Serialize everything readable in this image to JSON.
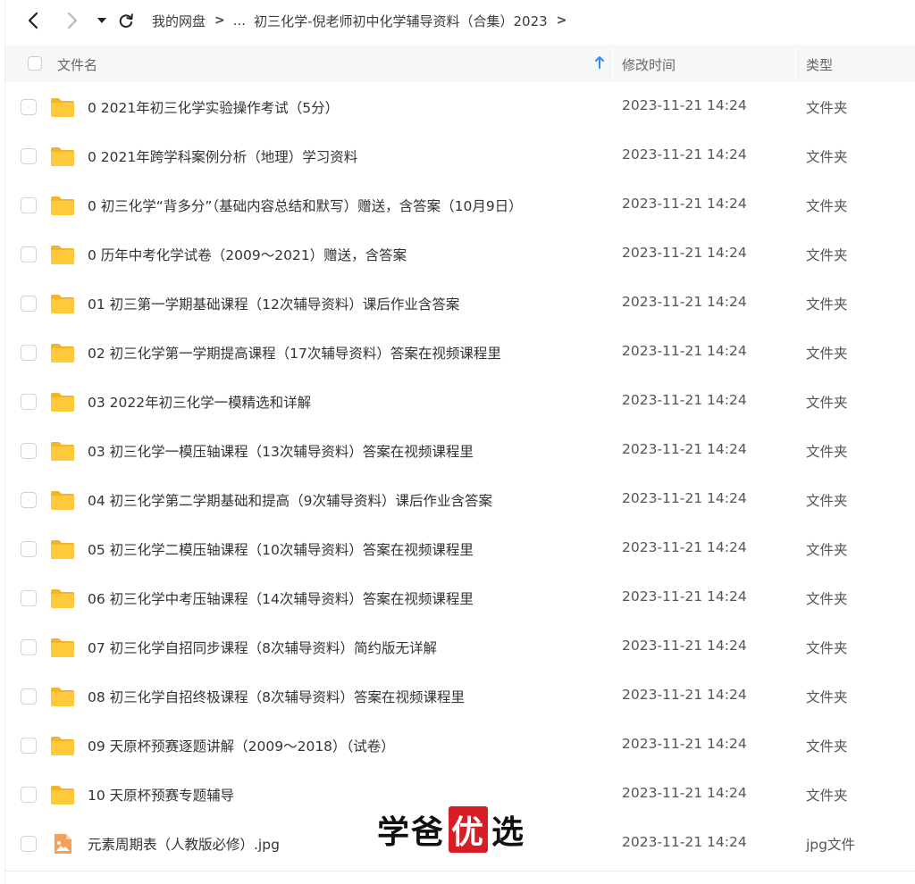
{
  "breadcrumb": {
    "root": "我的网盘",
    "ellipsis": "...",
    "current": "初三化学-倪老师初中化学辅导资料（合集）2023"
  },
  "table": {
    "columns": {
      "name": "文件名",
      "modified": "修改时间",
      "type": "类型"
    },
    "sort": {
      "column": "name",
      "direction": "asc"
    },
    "rows": [
      {
        "name": "0 2021年初三化学实验操作考试（5分）",
        "modified": "2023-11-21 14:24",
        "type": "文件夹",
        "icon": "folder-icon"
      },
      {
        "name": "0 2021年跨学科案例分析（地理）学习资料",
        "modified": "2023-11-21 14:24",
        "type": "文件夹",
        "icon": "folder-icon"
      },
      {
        "name": "0 初三化学“背多分”（基础内容总结和默写）赠送，含答案（10月9日）",
        "modified": "2023-11-21 14:24",
        "type": "文件夹",
        "icon": "folder-icon"
      },
      {
        "name": "0 历年中考化学试卷（2009～2021）赠送，含答案",
        "modified": "2023-11-21 14:24",
        "type": "文件夹",
        "icon": "folder-icon"
      },
      {
        "name": "01 初三第一学期基础课程（12次辅导资料）课后作业含答案",
        "modified": "2023-11-21 14:24",
        "type": "文件夹",
        "icon": "folder-icon"
      },
      {
        "name": "02 初三化学第一学期提高课程（17次辅导资料）答案在视频课程里",
        "modified": "2023-11-21 14:24",
        "type": "文件夹",
        "icon": "folder-icon"
      },
      {
        "name": "03 2022年初三化学一模精选和详解",
        "modified": "2023-11-21 14:24",
        "type": "文件夹",
        "icon": "folder-icon"
      },
      {
        "name": "03 初三化学一模压轴课程（13次辅导资料）答案在视频课程里",
        "modified": "2023-11-21 14:24",
        "type": "文件夹",
        "icon": "folder-icon"
      },
      {
        "name": "04 初三化学第二学期基础和提高（9次辅导资料）课后作业含答案",
        "modified": "2023-11-21 14:24",
        "type": "文件夹",
        "icon": "folder-icon"
      },
      {
        "name": "05 初三化学二模压轴课程（10次辅导资料）答案在视频课程里",
        "modified": "2023-11-21 14:24",
        "type": "文件夹",
        "icon": "folder-icon"
      },
      {
        "name": "06 初三化学中考压轴课程（14次辅导资料）答案在视频课程里",
        "modified": "2023-11-21 14:24",
        "type": "文件夹",
        "icon": "folder-icon"
      },
      {
        "name": "07 初三化学自招同步课程（8次辅导资料）简约版无详解",
        "modified": "2023-11-21 14:24",
        "type": "文件夹",
        "icon": "folder-icon"
      },
      {
        "name": "08 初三化学自招终极课程（8次辅导资料）答案在视频课程里",
        "modified": "2023-11-21 14:24",
        "type": "文件夹",
        "icon": "folder-icon"
      },
      {
        "name": "09 天原杯预赛逐题讲解（2009～2018）（试卷）",
        "modified": "2023-11-21 14:24",
        "type": "文件夹",
        "icon": "folder-icon"
      },
      {
        "name": "10 天原杯预赛专题辅导",
        "modified": "2023-11-21 14:24",
        "type": "文件夹",
        "icon": "folder-icon"
      },
      {
        "name": "元素周期表（人教版必修）.jpg",
        "modified": "2023-11-21 14:24",
        "type": "jpg文件",
        "icon": "image-file-icon"
      }
    ]
  },
  "watermark": {
    "part1": "学爸",
    "highlight": "优",
    "part2": "选"
  },
  "colors": {
    "folder": "#ffc93c",
    "folder_back": "#f5b325",
    "image_file": "#f5a05a",
    "sort_arrow": "#2f8cf0"
  }
}
